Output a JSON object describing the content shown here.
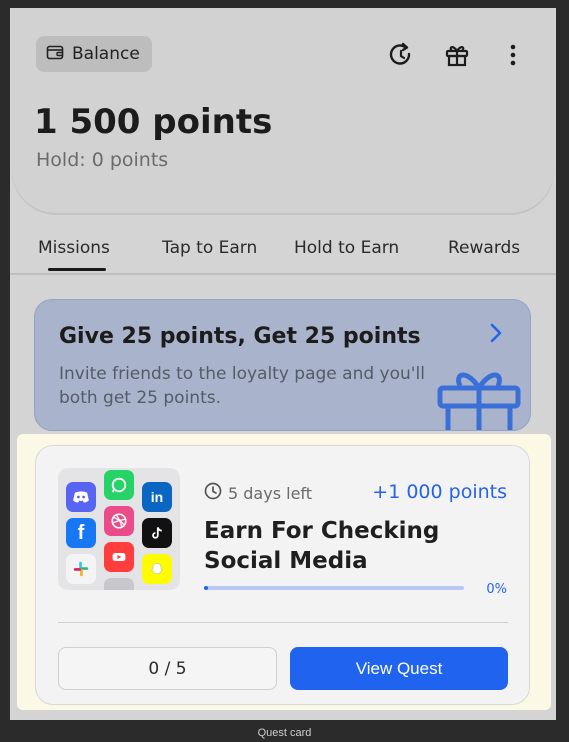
{
  "header": {
    "balance_label": "Balance",
    "points": "1 500 points",
    "hold": "Hold: 0 points",
    "icons": [
      "refresh-icon",
      "gift-icon",
      "more-vertical-icon"
    ]
  },
  "tabs": [
    {
      "label": "Missions",
      "active": true
    },
    {
      "label": "Tap to Earn",
      "active": false
    },
    {
      "label": "Hold to Earn",
      "active": false
    },
    {
      "label": "Rewards",
      "active": false
    }
  ],
  "invite": {
    "title": "Give 25 points, Get 25 points",
    "description": "Invite friends to the loyalty page and you'll both get 25 points."
  },
  "quest": {
    "time_left": "5 days left",
    "reward": "+1 000 points",
    "title": "Earn For Checking Social Media",
    "progress_label": "0%",
    "progress_fraction": 0.0,
    "counter": "0 / 5",
    "view_button": "View Quest",
    "apps": [
      "discord",
      "whatsapp",
      "linkedin",
      "facebook",
      "dribbble",
      "tiktok",
      "slack",
      "youtube",
      "snapchat"
    ]
  },
  "caption": "Quest card",
  "colors": {
    "accent": "#1f63ee",
    "link": "#2563eb",
    "highlight": "#fbf9e6"
  }
}
